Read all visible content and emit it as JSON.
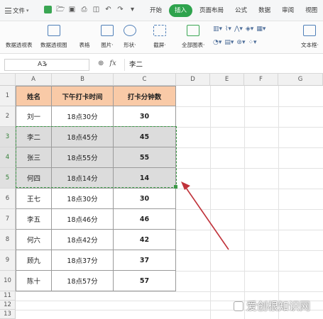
{
  "menubar": {
    "file_label": "文件",
    "tabs": [
      "开始",
      "插入",
      "页面布局",
      "公式",
      "数据",
      "审阅",
      "视图"
    ],
    "active_tab": "插入"
  },
  "ribbon": {
    "buttons": [
      {
        "label": "数据透视表",
        "icon": "pivot-table-icon"
      },
      {
        "label": "数据透视图",
        "icon": "pivot-chart-icon"
      },
      {
        "label": "表格",
        "icon": "table-icon"
      },
      {
        "label": "图片·",
        "icon": "picture-icon"
      },
      {
        "label": "形状·",
        "icon": "shape-icon"
      },
      {
        "label": "截屏·",
        "icon": "screenshot-icon"
      },
      {
        "label": "全部图表·",
        "icon": "all-charts-icon"
      },
      {
        "label": "文本框·",
        "icon": "textbox-icon"
      }
    ]
  },
  "formula_bar": {
    "name_box": "A3",
    "content": "李二"
  },
  "sheet": {
    "columns": [
      "A",
      "B",
      "C",
      "D",
      "E",
      "F",
      "G"
    ],
    "rows": [
      "1",
      "2",
      "3",
      "4",
      "5",
      "6",
      "7",
      "8",
      "9",
      "10",
      "11",
      "12",
      "13"
    ],
    "headers": [
      "姓名",
      "下午打卡时间",
      "打卡分钟数"
    ],
    "data": [
      [
        "刘一",
        "18点30分",
        "30"
      ],
      [
        "李二",
        "18点45分",
        "45"
      ],
      [
        "张三",
        "18点55分",
        "55"
      ],
      [
        "何四",
        "18点14分",
        "14"
      ],
      [
        "王七",
        "18点30分",
        "30"
      ],
      [
        "李五",
        "18点46分",
        "46"
      ],
      [
        "何六",
        "18点42分",
        "42"
      ],
      [
        "顾九",
        "18点37分",
        "37"
      ],
      [
        "陈十",
        "18点57分",
        "57"
      ]
    ],
    "selected_rows": [
      "3",
      "4",
      "5"
    ]
  },
  "colors": {
    "header_fill": "#f9caa7",
    "selection_fill": "#dcdcdc",
    "marquee": "#3c9a47",
    "accent_tab": "#2ea34d",
    "arrow": "#c0323a"
  },
  "watermark": "爱创根知识网"
}
